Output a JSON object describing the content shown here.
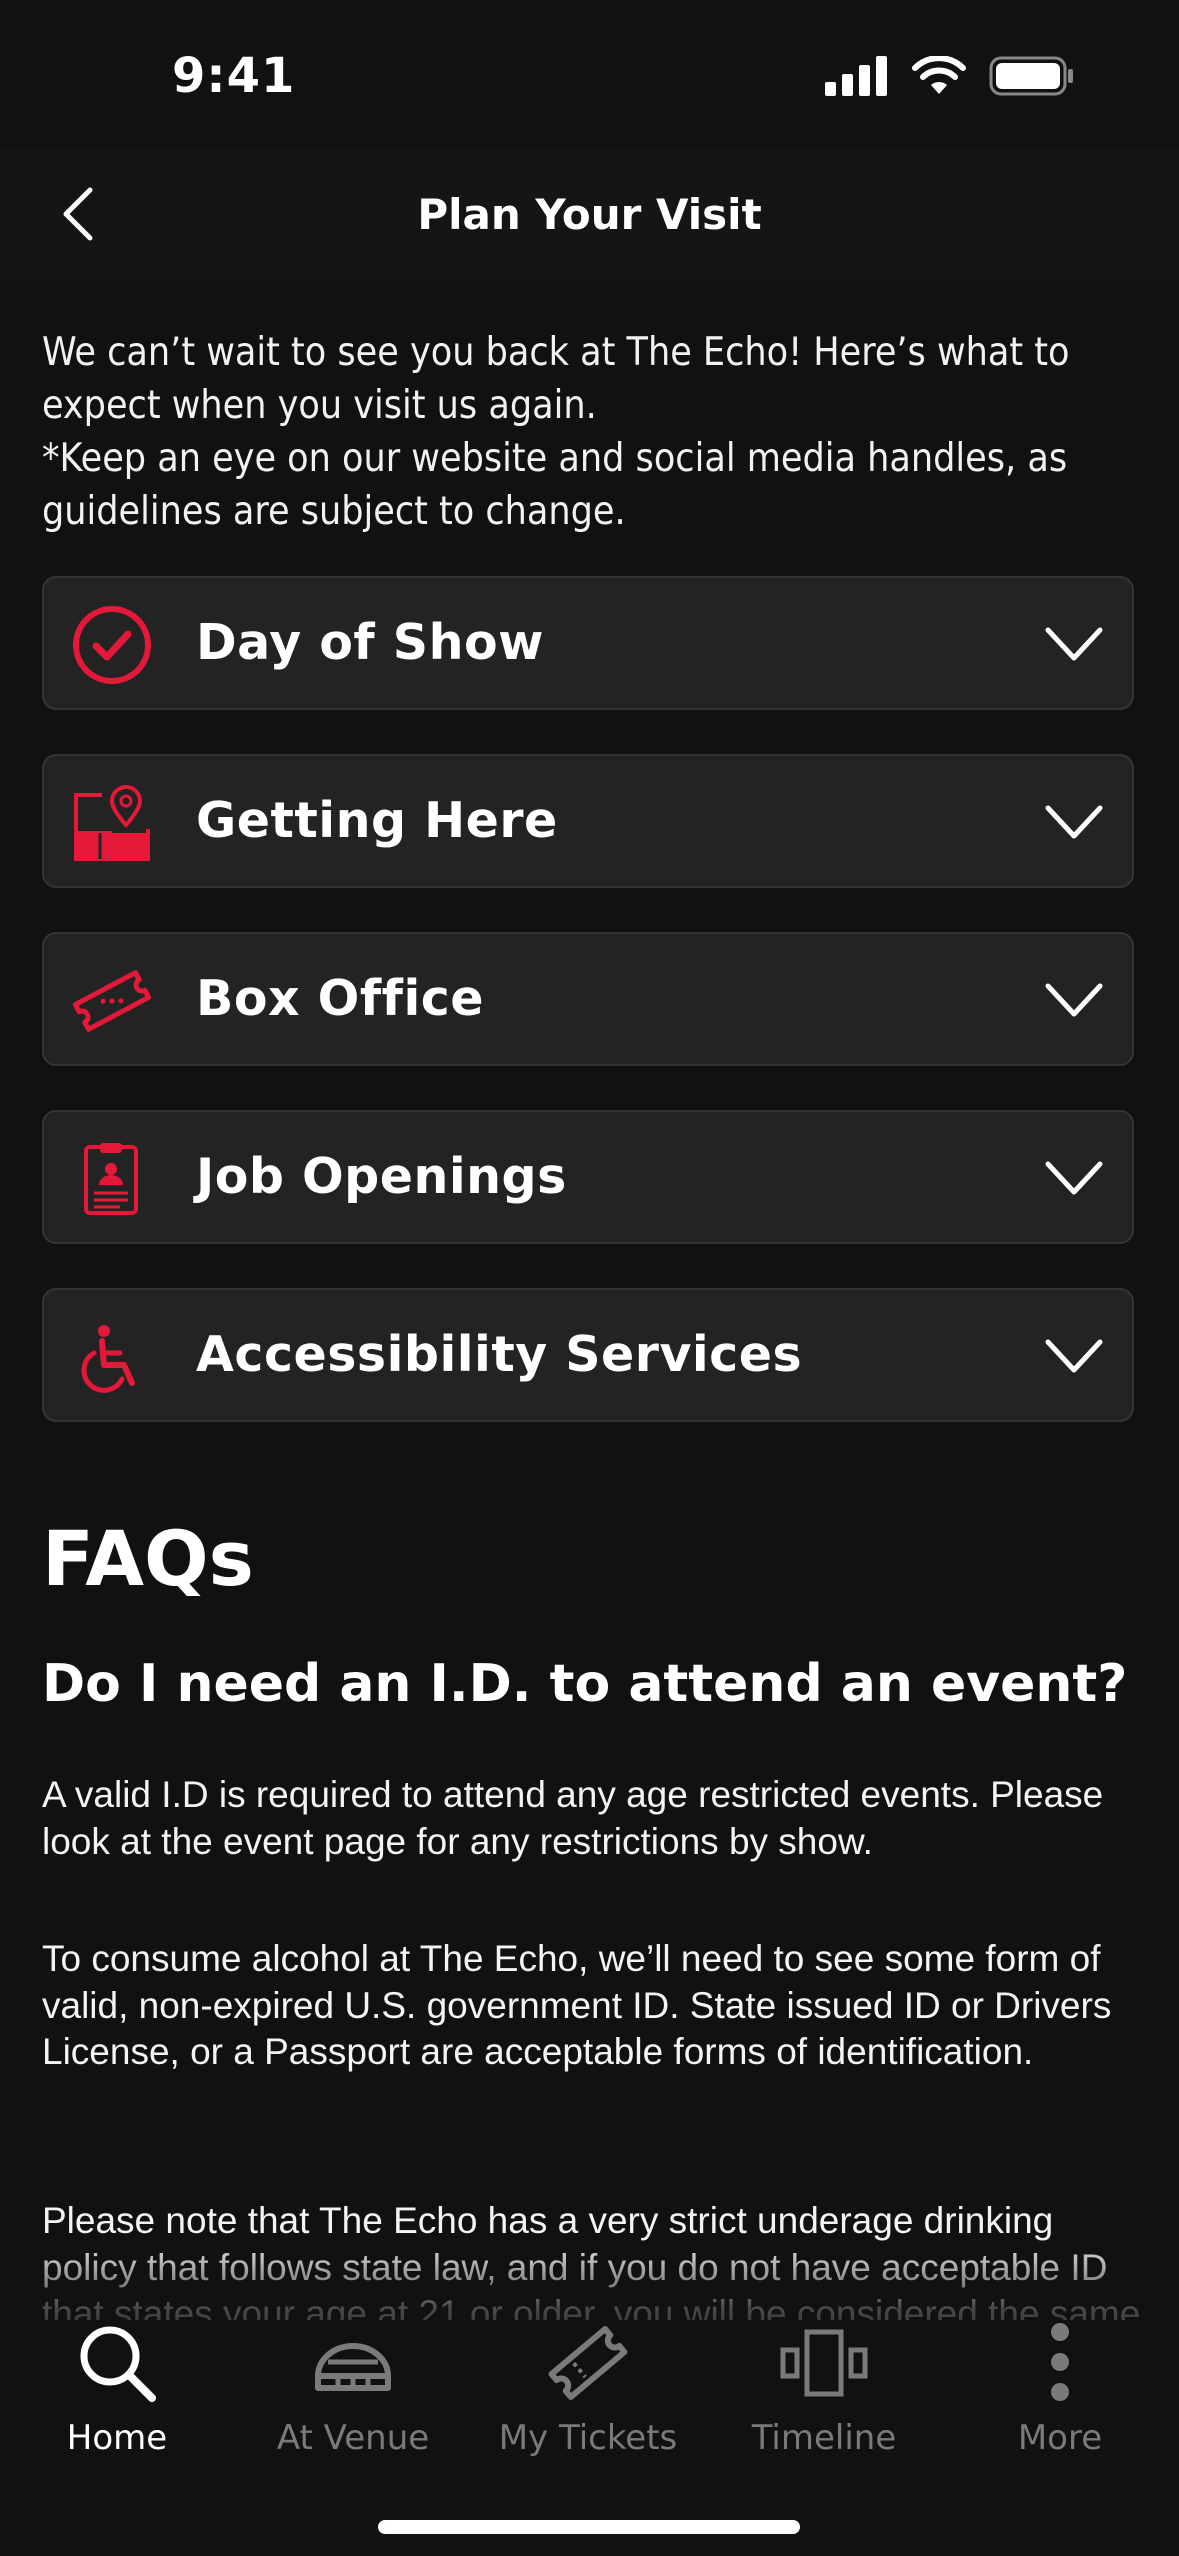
{
  "status_bar": {
    "time": "9:41"
  },
  "nav": {
    "title": "Plan Your Visit"
  },
  "intro": {
    "line1": "We can’t wait to see you back at The Echo! Here’s what to expect when you visit us again.",
    "line2": "*Keep an eye on our website and social media handles, as guidelines are subject to change."
  },
  "accordion": [
    {
      "label": "Day of Show",
      "icon": "check-circle-icon"
    },
    {
      "label": "Getting Here",
      "icon": "map-pin-icon"
    },
    {
      "label": "Box Office",
      "icon": "ticket-icon"
    },
    {
      "label": "Job Openings",
      "icon": "job-clipboard-icon"
    },
    {
      "label": "Accessibility Services",
      "icon": "wheelchair-icon"
    }
  ],
  "faq": {
    "heading": "FAQs",
    "question": "Do I need an I.D. to attend an event?",
    "paragraphs": [
      "A valid I.D is required to attend any age restricted events. Please look at the event page for any restrictions by show.",
      "To consume alcohol at The Echo, we’ll need to see some form of valid, non-expired U.S. government ID. State issued ID or Drivers License, or a Passport are acceptable forms of identification.",
      "Please note that The Echo has a very strict underage drinking policy that follows state law, and if you do not have acceptable ID that states your age at 21 or older, you will be considered the same as a minor and will not be able to"
    ]
  },
  "tabs": [
    {
      "label": "Home",
      "icon": "search-icon",
      "active": true
    },
    {
      "label": "At Venue",
      "icon": "venue-icon",
      "active": false
    },
    {
      "label": "My Tickets",
      "icon": "ticket-icon",
      "active": false
    },
    {
      "label": "Timeline",
      "icon": "timeline-icon",
      "active": false
    },
    {
      "label": "More",
      "icon": "more-vertical-icon",
      "active": false
    }
  ],
  "colors": {
    "accent": "#e4193a",
    "background": "#111111",
    "card": "#232323"
  }
}
